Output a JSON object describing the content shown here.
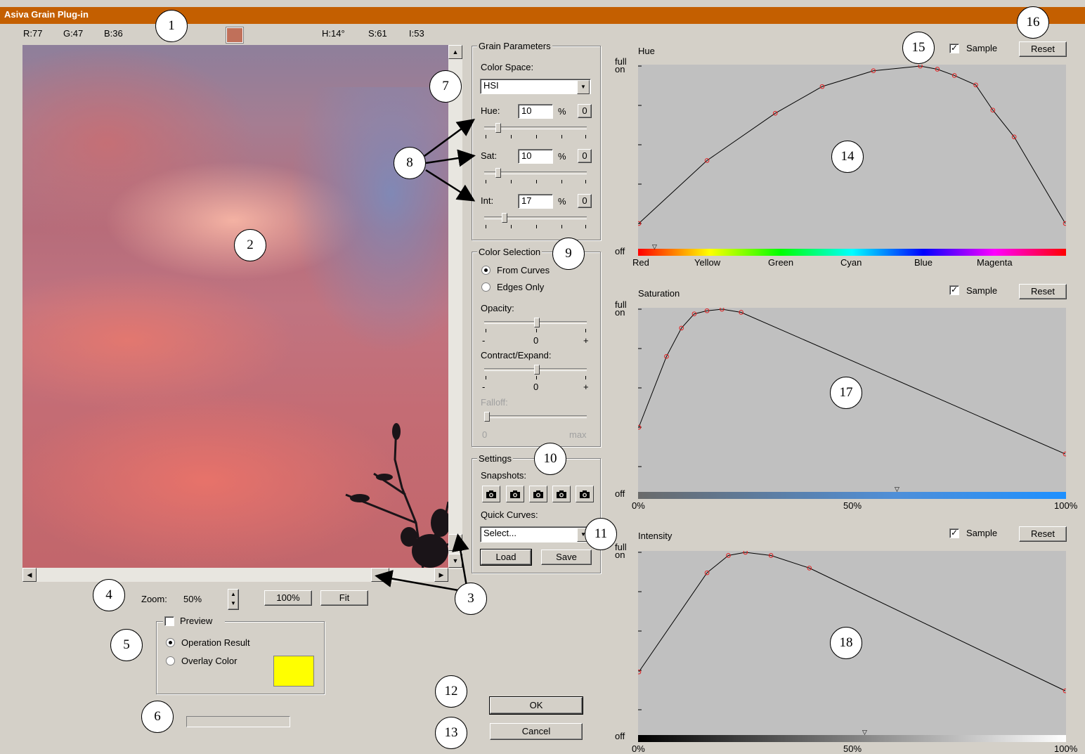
{
  "window": {
    "title": "Asiva Grain Plug-in"
  },
  "readout": {
    "r": "R:77",
    "g": "G:47",
    "b": "B:36",
    "h": "H:14°",
    "s": "S:61",
    "i": "I:53",
    "swatch_color": "#c0705a"
  },
  "zoom": {
    "label": "Zoom:",
    "value": "50%",
    "btn_100": "100%",
    "btn_fit": "Fit"
  },
  "preview": {
    "label": "Preview",
    "checked": false,
    "opt_result": "Operation Result",
    "opt_overlay": "Overlay Color",
    "overlay_color": "#ffff00"
  },
  "grain": {
    "title": "Grain Parameters",
    "color_space_label": "Color Space:",
    "color_space_value": "HSI",
    "hue_label": "Hue:",
    "hue_value": "10",
    "sat_label": "Sat:",
    "sat_value": "10",
    "int_label": "Int:",
    "int_value": "17",
    "pct": "%",
    "zero_btn": "0"
  },
  "color_selection": {
    "title": "Color Selection",
    "from_curves": "From Curves",
    "edges_only": "Edges Only",
    "opacity_label": "Opacity:",
    "contract_label": "Contract/Expand:",
    "falloff_label": "Falloff:",
    "minus": "-",
    "zero": "0",
    "plus": "+",
    "falloff_min": "0",
    "falloff_max": "max"
  },
  "settings": {
    "title": "Settings",
    "snapshots_label": "Snapshots:",
    "quick_curves_label": "Quick Curves:",
    "quick_curves_value": "Select...",
    "load": "Load",
    "save": "Save"
  },
  "dialog": {
    "ok": "OK",
    "cancel": "Cancel"
  },
  "curves": {
    "full": "full",
    "on": "on",
    "off": "off",
    "sample": "Sample",
    "reset": "Reset",
    "hue": {
      "title": "Hue",
      "axis": [
        "Red",
        "Yellow",
        "Green",
        "Cyan",
        "Blue",
        "Magenta"
      ]
    },
    "saturation": {
      "title": "Saturation",
      "axis": [
        "0%",
        "50%",
        "100%"
      ]
    },
    "intensity": {
      "title": "Intensity",
      "axis": [
        "0%",
        "50%",
        "100%"
      ]
    }
  },
  "chart_data": [
    {
      "type": "line",
      "name": "hue_curve",
      "x": [
        0.0,
        0.16,
        0.32,
        0.43,
        0.55,
        0.66,
        0.7,
        0.74,
        0.79,
        0.83,
        0.88,
        1.0
      ],
      "y": [
        0.0,
        0.4,
        0.7,
        0.87,
        0.97,
        1.0,
        0.98,
        0.94,
        0.88,
        0.72,
        0.55,
        0.0
      ]
    },
    {
      "type": "line",
      "name": "saturation_curve",
      "x": [
        0.0,
        0.065,
        0.1,
        0.13,
        0.16,
        0.195,
        0.24,
        1.0
      ],
      "y": [
        0.25,
        0.7,
        0.88,
        0.97,
        0.99,
        1.0,
        0.98,
        0.08
      ]
    },
    {
      "type": "line",
      "name": "intensity_curve",
      "x": [
        0.0,
        0.16,
        0.21,
        0.25,
        0.31,
        0.4,
        1.0
      ],
      "y": [
        0.24,
        0.87,
        0.98,
        1.0,
        0.98,
        0.9,
        0.12
      ]
    }
  ],
  "callouts": [
    "1",
    "2",
    "3",
    "4",
    "5",
    "6",
    "7",
    "8",
    "9",
    "10",
    "11",
    "12",
    "13",
    "14",
    "15",
    "16",
    "17",
    "18"
  ]
}
